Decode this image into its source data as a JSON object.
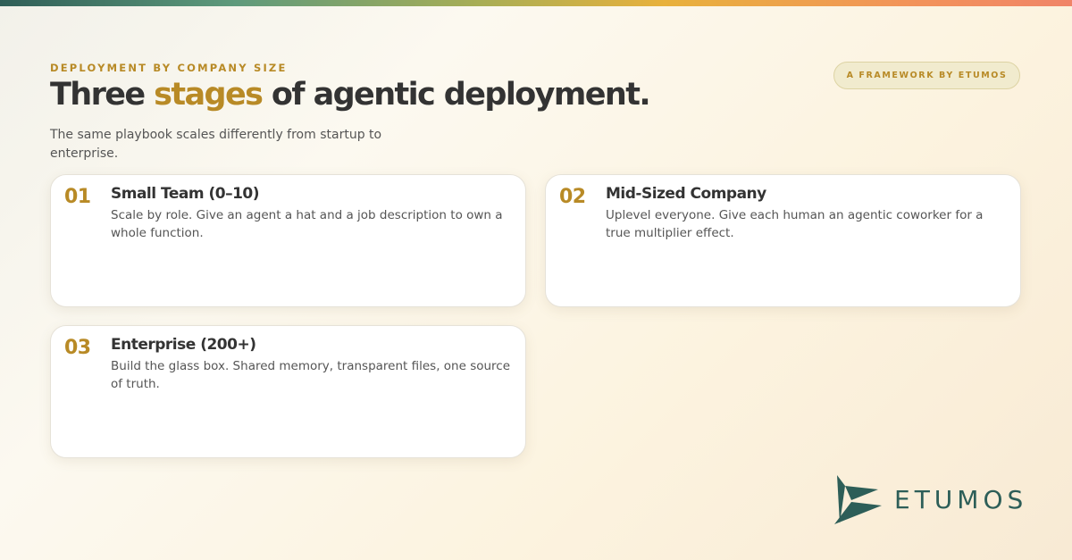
{
  "eyebrow": "DEPLOYMENT BY COMPANY SIZE",
  "headline": {
    "before": "Three ",
    "accent": "stages",
    "after": " of agentic deployment."
  },
  "subtitle": "The same playbook scales differently from startup to enterprise.",
  "pill": "A FRAMEWORK BY ETUMOS",
  "cards": [
    {
      "number": "01",
      "title": "Small Team (0–10)",
      "description": "Scale by role. Give an agent a hat and a job description to own a whole function."
    },
    {
      "number": "02",
      "title": "Mid-Sized Company",
      "description": "Uplevel everyone. Give each human an agentic coworker for a true multiplier effect."
    },
    {
      "number": "03",
      "title": "Enterprise (200+)",
      "description": "Build the glass box. Shared memory, transparent files, one source of truth."
    }
  ],
  "brand": {
    "logo_icon": "etumos-logo-icon",
    "wordmark": "ETUMOS"
  },
  "colors": {
    "accent": "#b88a26",
    "text": "#333333",
    "brand_teal": "#2d5e58",
    "card_bg": "#ffffff"
  }
}
